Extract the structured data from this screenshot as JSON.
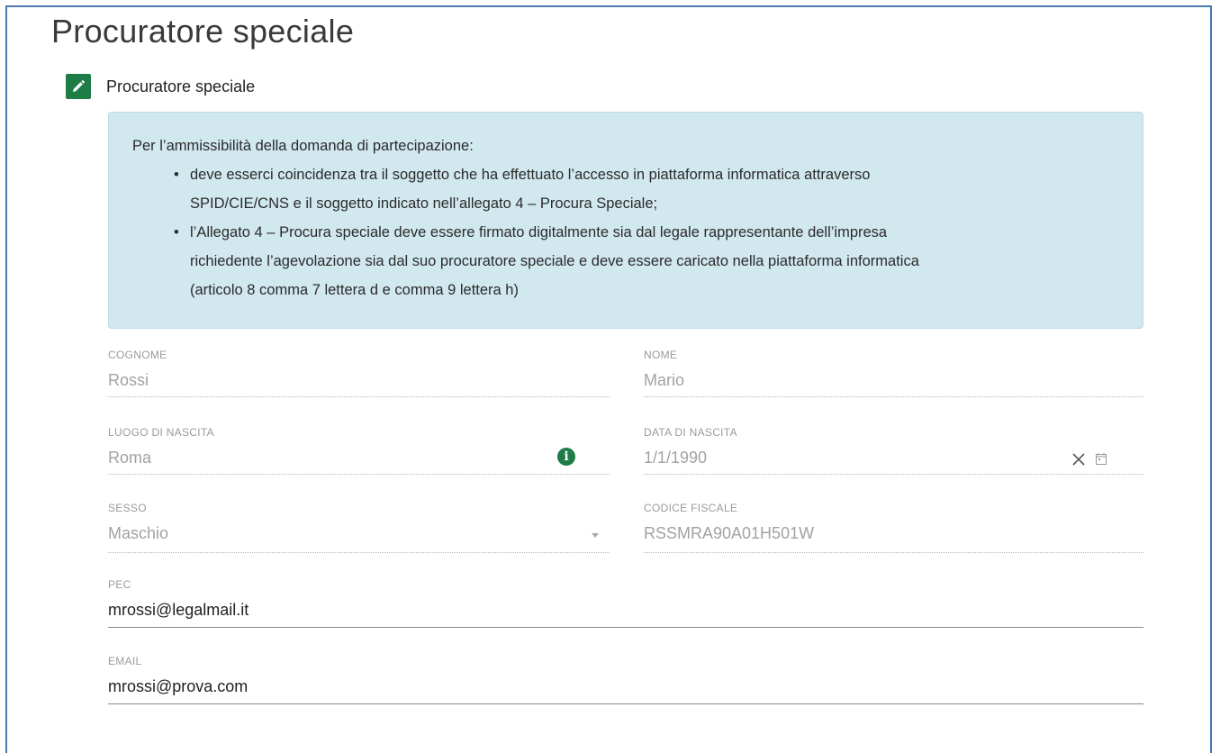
{
  "page_title": "Procuratore speciale",
  "section": {
    "title": "Procuratore speciale",
    "icon": "pencil-icon"
  },
  "info_box": {
    "intro": "Per l’ammissibilità della domanda di partecipazione:",
    "bullets": [
      [
        "deve esserci coincidenza tra il soggetto che ha effettuato l’accesso in piattaforma informatica attraverso",
        "SPID/CIE/CNS e il soggetto indicato nell’allegato 4 – Procura Speciale;"
      ],
      [
        "l’Allegato 4 – Procura speciale deve essere firmato digitalmente sia dal legale rappresentante dell’impresa",
        "richiedente l’agevolazione sia dal suo procuratore speciale e deve essere caricato nella piattaforma informatica",
        "(articolo 8 comma 7 lettera d e comma 9 lettera h)"
      ]
    ]
  },
  "fields": {
    "cognome": {
      "label": "COGNOME",
      "value": "Rossi"
    },
    "nome": {
      "label": "NOME",
      "value": "Mario"
    },
    "luogo_nascita": {
      "label": "LUOGO DI NASCITA",
      "value": "Roma",
      "icon": "info-icon"
    },
    "data_nascita": {
      "label": "DATA DI NASCITA",
      "value": "1/1/1990",
      "icons": [
        "clear-icon",
        "calendar-icon"
      ]
    },
    "sesso": {
      "label": "SESSO",
      "value": "Maschio",
      "icon": "chevron-down-icon"
    },
    "codice_fiscale": {
      "label": "CODICE FISCALE",
      "value": "RSSMRA90A01H501W"
    },
    "pec": {
      "label": "PEC",
      "value": "mrossi@legalmail.it"
    },
    "email": {
      "label": "EMAIL",
      "value": "mrossi@prova.com"
    }
  },
  "colors": {
    "accent_green": "#1e7c46",
    "info_bg": "#d1e8ef",
    "frame_border": "#4a78b0"
  }
}
